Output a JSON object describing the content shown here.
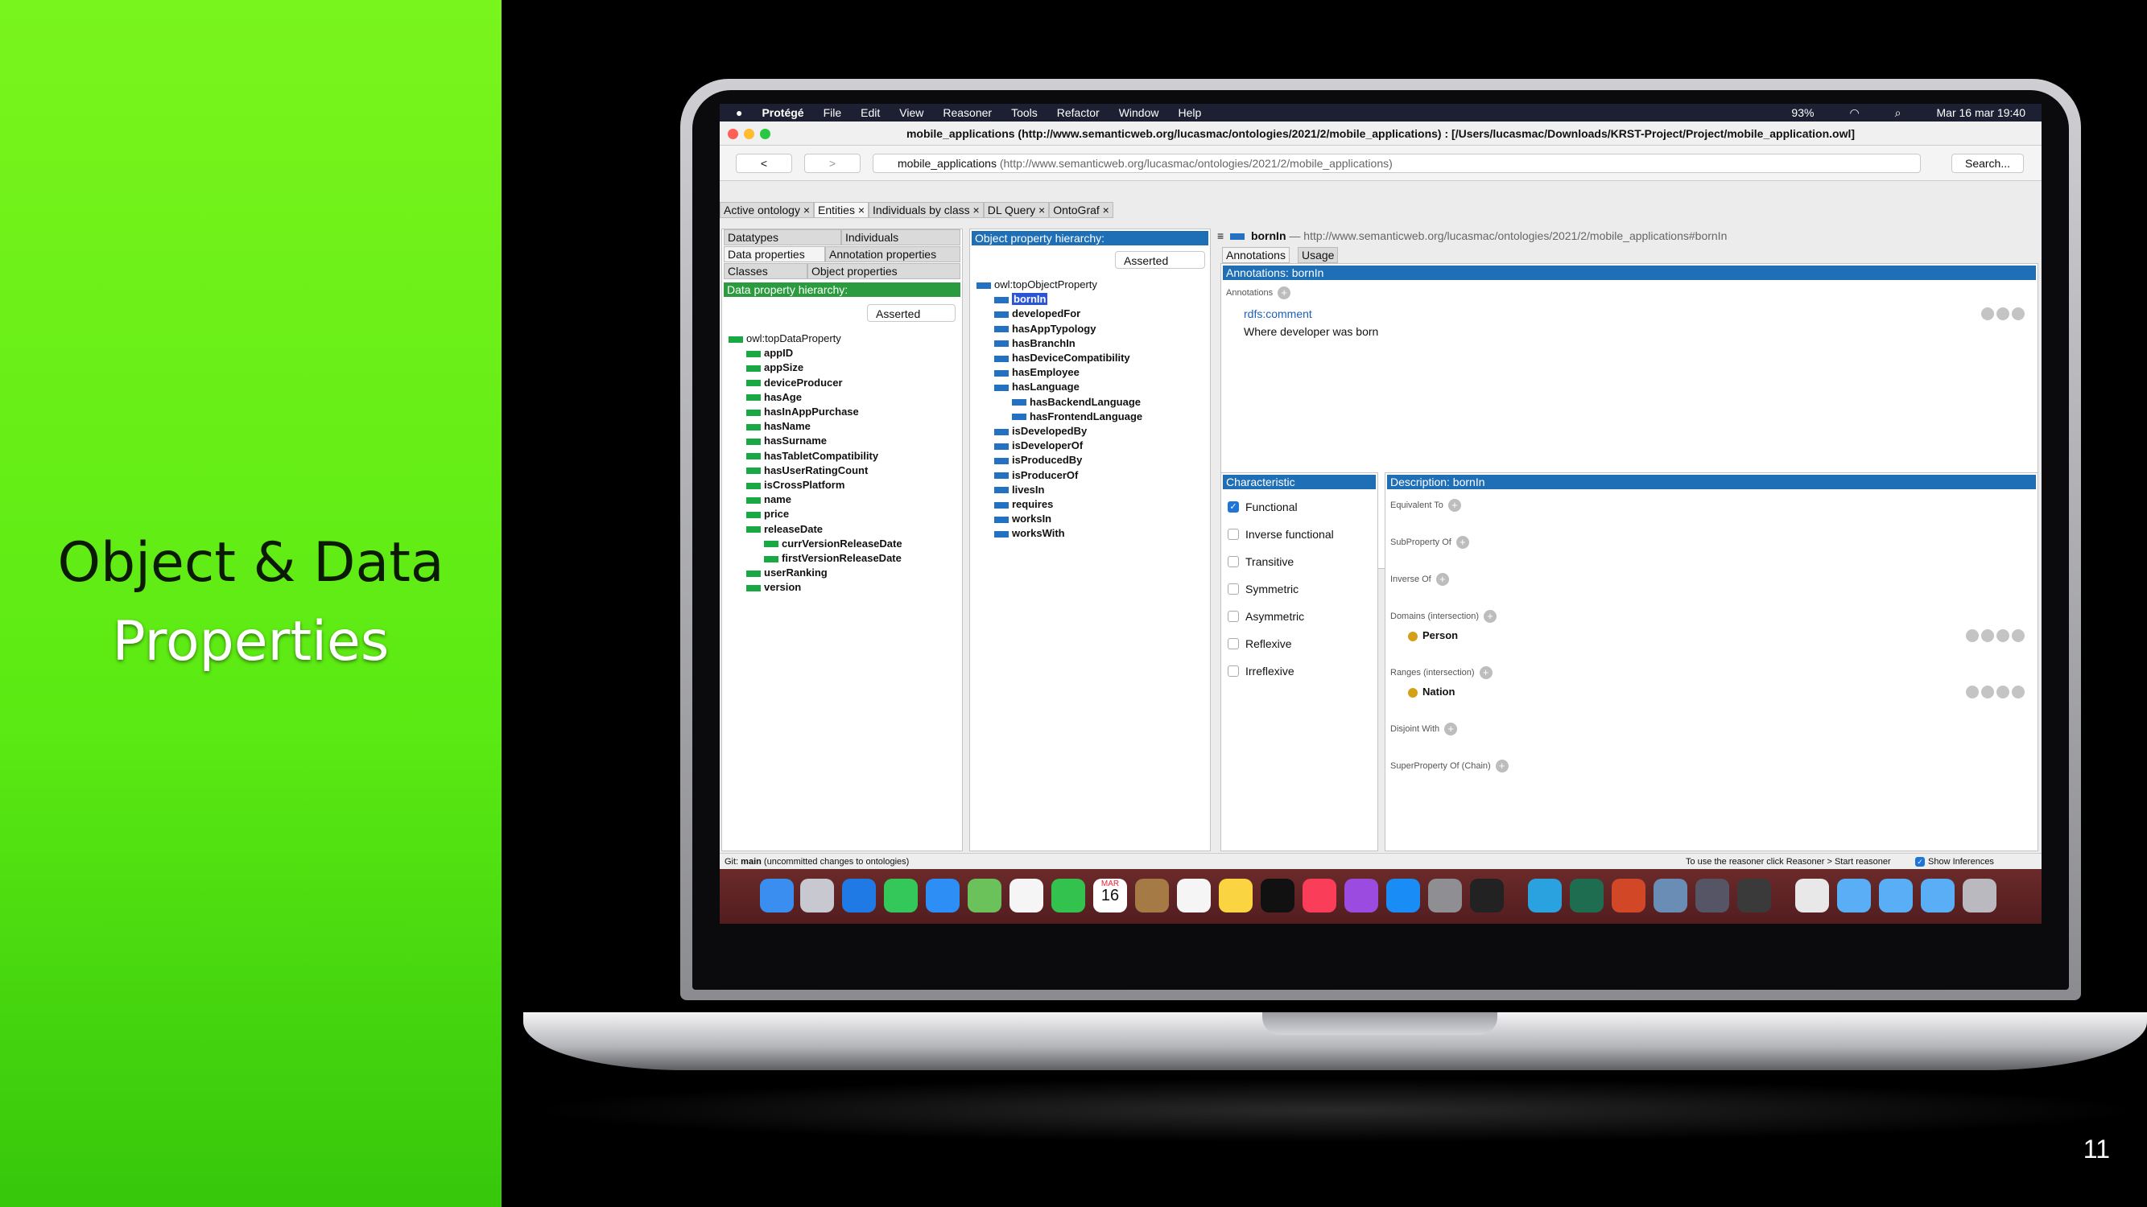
{
  "slide": {
    "title_line1": "Object & Data",
    "title_line2": "Properties",
    "page_number": "11"
  },
  "menubar": {
    "app": "Protégé",
    "items": [
      "File",
      "Edit",
      "View",
      "Reasoner",
      "Tools",
      "Refactor",
      "Window",
      "Help"
    ],
    "battery": "93%",
    "datetime": "Mar 16 mar  19:40"
  },
  "window": {
    "title": "mobile_applications (http://www.semanticweb.org/lucasmac/ontologies/2021/2/mobile_applications)  : [/Users/lucasmac/Downloads/KRST-Project/Project/mobile_application.owl]",
    "back": "<",
    "forward": ">",
    "url_name": "mobile_applications",
    "url_iri": "(http://www.semanticweb.org/lucasmac/ontologies/2021/2/mobile_applications)",
    "search": "Search..."
  },
  "tabs": [
    "Active ontology",
    "Entities",
    "Individuals by class",
    "DL Query",
    "OntoGraf"
  ],
  "left_tabs": [
    "Datatypes",
    "Individuals",
    "Data properties",
    "Annotation properties",
    "Classes",
    "Object properties"
  ],
  "data_panel": {
    "title": "Data property hierarchy:",
    "mode": "Asserted",
    "root": "owl:topDataProperty",
    "items": [
      "appID",
      "appSize",
      "deviceProducer",
      "hasAge",
      "hasInAppPurchase",
      "hasName",
      "hasSurname",
      "hasTabletCompatibility",
      "hasUserRatingCount",
      "isCrossPlatform",
      "name",
      "price",
      "releaseDate",
      "userRanking",
      "version"
    ],
    "release_children": [
      "currVersionReleaseDate",
      "firstVersionReleaseDate"
    ]
  },
  "object_panel": {
    "title": "Object property hierarchy:",
    "mode": "Asserted",
    "root": "owl:topObjectProperty",
    "selected": "bornIn",
    "items": [
      "developedFor",
      "hasAppTypology",
      "hasBranchIn",
      "hasDeviceCompatibility",
      "hasEmployee",
      "hasLanguage"
    ],
    "language_children": [
      "hasBackendLanguage",
      "hasFrontendLanguage"
    ],
    "items2": [
      "isDevelopedBy",
      "isDeveloperOf",
      "isProducedBy",
      "isProducerOf",
      "livesIn",
      "requires",
      "worksIn",
      "worksWith"
    ]
  },
  "entity": {
    "name": "bornIn",
    "iri": "— http://www.semanticweb.org/lucasmac/ontologies/2021/2/mobile_applications#bornIn"
  },
  "annot": {
    "tabs": [
      "Annotations",
      "Usage"
    ],
    "header": "Annotations: bornIn",
    "label": "Annotations",
    "prop": "rdfs:comment",
    "value": "Where developer was born"
  },
  "chars": {
    "header": "Characteristic",
    "items": [
      "Functional",
      "Inverse functional",
      "Transitive",
      "Symmetric",
      "Asymmetric",
      "Reflexive",
      "Irreflexive"
    ]
  },
  "desc": {
    "header": "Description: bornIn",
    "equiv": "Equivalent To",
    "subprop": "SubProperty Of",
    "inverse": "Inverse Of",
    "domains": "Domains (intersection)",
    "domain_val": "Person",
    "ranges": "Ranges (intersection)",
    "range_val": "Nation",
    "disjoint": "Disjoint With",
    "chain": "SuperProperty Of (Chain)"
  },
  "status": {
    "git": "Git: ",
    "branch": "main",
    "git_note": " (uncommitted changes to ontologies)",
    "reasoner": "To use the reasoner click Reasoner > Start reasoner",
    "show_inf": "Show Inferences"
  },
  "dock": {
    "calendar_month": "MAR",
    "calendar_day": "16"
  }
}
